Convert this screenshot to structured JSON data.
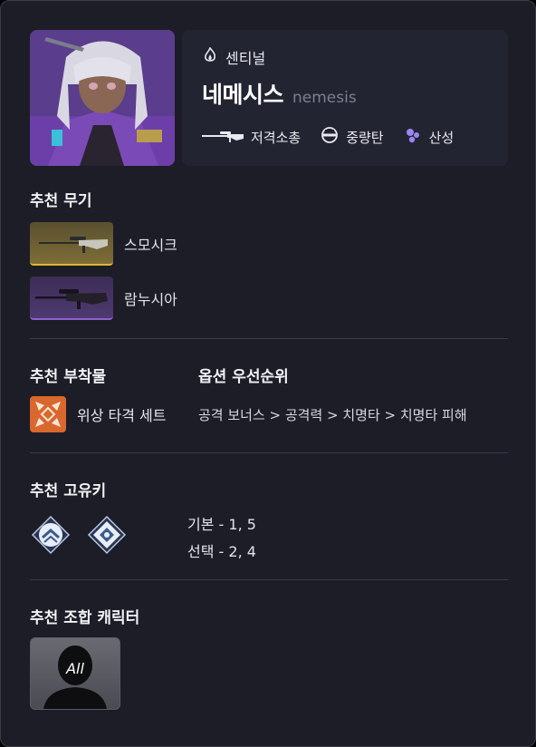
{
  "character": {
    "class_icon": "flame-crest-icon",
    "class_label": "센티널",
    "name_ko": "네메시스",
    "name_en": "nemesis",
    "stats": [
      {
        "icon": "sniper-rifle-icon",
        "label": "저격소총"
      },
      {
        "icon": "heavy-ammo-icon",
        "label": "중량탄"
      },
      {
        "icon": "dissolve-icon",
        "label": "산성"
      }
    ]
  },
  "sections": {
    "weapons_title": "추천 무기",
    "attachments_title": "추천 부착물",
    "options_title": "옵션 우선순위",
    "keys_title": "추천 고유키",
    "combo_title": "추천 조합 캐릭터"
  },
  "weapons": [
    {
      "label": "스모시크",
      "rarity_color": "#e0b537"
    },
    {
      "label": "람누시아",
      "rarity_color": "#8f5fd0"
    }
  ],
  "attachment_set": {
    "icon": "phase-strike-set-icon",
    "label": "위상 타격 세트",
    "color": "#d9672e"
  },
  "option_priority": "공격 보너스 > 공격력 > 치명타 > 치명타 피해",
  "keys": {
    "icons": [
      "key-chevron-icon",
      "key-diamond-icon"
    ],
    "basic": "기본 - 1, 5",
    "choice": "선택 - 2, 4"
  },
  "combo": {
    "label": "All"
  }
}
